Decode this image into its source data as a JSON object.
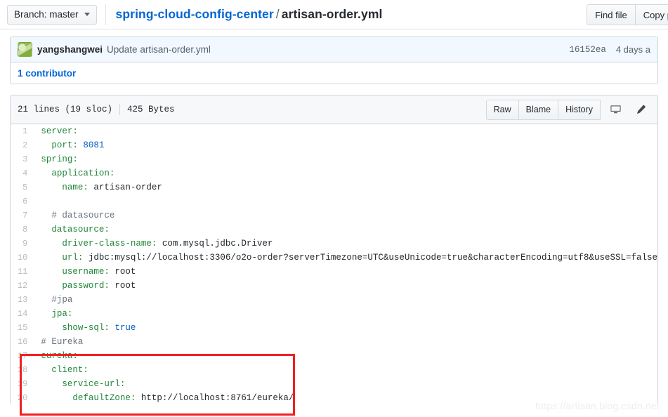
{
  "topbar": {
    "branch_label": "Branch: master",
    "repo_name": "spring-cloud-config-center",
    "path_separator": "/",
    "file_name": "artisan-order.yml",
    "find_file_label": "Find file",
    "copy_path_label": "Copy path"
  },
  "commit": {
    "author": "yangshangwei",
    "message": "Update artisan-order.yml",
    "sha": "16152ea",
    "relative_time": "4 days a",
    "contributors_label": "1 contributor"
  },
  "file_header": {
    "lines_label": "21 lines (19 sloc)",
    "size_label": "425 Bytes",
    "raw_label": "Raw",
    "blame_label": "Blame",
    "history_label": "History",
    "desktop_icon": "desktop-monitor-icon",
    "edit_icon": "pencil-icon"
  },
  "code": {
    "language": "yaml",
    "lines": [
      {
        "n": 1,
        "tokens": [
          {
            "t": "server:",
            "c": "k"
          }
        ]
      },
      {
        "n": 2,
        "tokens": [
          {
            "t": "  port: ",
            "c": "k"
          },
          {
            "t": "8081",
            "c": "n"
          }
        ]
      },
      {
        "n": 3,
        "tokens": [
          {
            "t": "spring:",
            "c": "k"
          }
        ]
      },
      {
        "n": 4,
        "tokens": [
          {
            "t": "  application:",
            "c": "k"
          }
        ]
      },
      {
        "n": 5,
        "tokens": [
          {
            "t": "    name: ",
            "c": "k"
          },
          {
            "t": "artisan-order",
            "c": "s"
          }
        ]
      },
      {
        "n": 6,
        "tokens": [
          {
            "t": "",
            "c": "s"
          }
        ]
      },
      {
        "n": 7,
        "tokens": [
          {
            "t": "  # datasource",
            "c": "c"
          }
        ]
      },
      {
        "n": 8,
        "tokens": [
          {
            "t": "  datasource:",
            "c": "k"
          }
        ]
      },
      {
        "n": 9,
        "tokens": [
          {
            "t": "    driver-class-name: ",
            "c": "k"
          },
          {
            "t": "com.mysql.jdbc.Driver",
            "c": "s"
          }
        ]
      },
      {
        "n": 10,
        "tokens": [
          {
            "t": "    url: ",
            "c": "k"
          },
          {
            "t": "jdbc:mysql://localhost:3306/o2o-order?serverTimezone=UTC&useUnicode=true&characterEncoding=utf8&useSSL=false",
            "c": "s"
          }
        ]
      },
      {
        "n": 11,
        "tokens": [
          {
            "t": "    username: ",
            "c": "k"
          },
          {
            "t": "root",
            "c": "s"
          }
        ]
      },
      {
        "n": 12,
        "tokens": [
          {
            "t": "    password: ",
            "c": "k"
          },
          {
            "t": "root",
            "c": "s"
          }
        ]
      },
      {
        "n": 13,
        "tokens": [
          {
            "t": "  #jpa",
            "c": "c"
          }
        ]
      },
      {
        "n": 14,
        "tokens": [
          {
            "t": "  jpa:",
            "c": "k"
          }
        ]
      },
      {
        "n": 15,
        "tokens": [
          {
            "t": "    show-sql: ",
            "c": "k"
          },
          {
            "t": "true",
            "c": "n"
          }
        ]
      },
      {
        "n": 16,
        "tokens": [
          {
            "t": "# Eureka",
            "c": "c"
          }
        ]
      },
      {
        "n": 17,
        "tokens": [
          {
            "t": "eureka:",
            "c": "k"
          }
        ]
      },
      {
        "n": 18,
        "tokens": [
          {
            "t": "  client:",
            "c": "k"
          }
        ]
      },
      {
        "n": 19,
        "tokens": [
          {
            "t": "    service-url:",
            "c": "k"
          }
        ]
      },
      {
        "n": 20,
        "tokens": [
          {
            "t": "      defaultZone: ",
            "c": "k"
          },
          {
            "t": "http://localhost:8761/eureka/",
            "c": "s"
          }
        ]
      }
    ]
  },
  "annotation": {
    "highlight_color": "#f02020",
    "highlight_lines": "17-20"
  },
  "watermark": {
    "text": "https://artisan.blog.csdn.net"
  }
}
